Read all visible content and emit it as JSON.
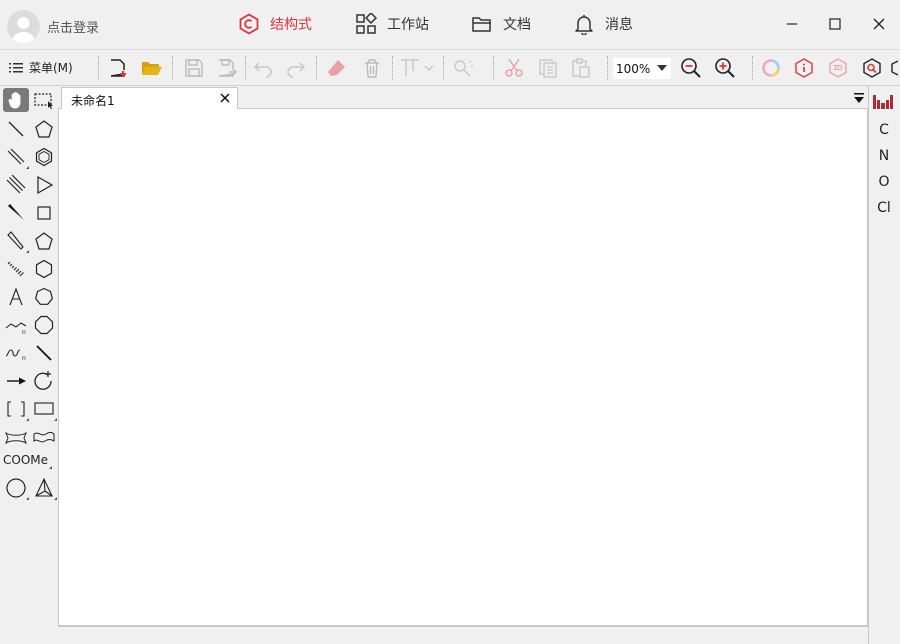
{
  "user": {
    "login_label": "点击登录"
  },
  "nav": [
    {
      "label": "结构式",
      "icon": "structure-icon",
      "active": true
    },
    {
      "label": "工作站",
      "icon": "workstation-icon"
    },
    {
      "label": "文档",
      "icon": "folder-icon"
    },
    {
      "label": "消息",
      "icon": "bell-icon"
    }
  ],
  "toolbar": {
    "menu_label": "菜单(M)",
    "zoom_value": "100%"
  },
  "tools": [
    "hand-tool",
    "marquee-select-tool",
    "single-bond-tool",
    "pentagon-ring-tool",
    "double-bond-tool",
    "hexagon-ring-tool",
    "triple-bond-tool",
    "triangle-ring-tool",
    "wedge-bond-tool",
    "square-ring-tool",
    "hashed-wedge-bond-tool",
    "pentagon-ring-tool-2",
    "hashed-bond-tool",
    "hexagon-ring-tool-2",
    "text-tool",
    "heptagon-ring-tool",
    "chain-tool",
    "octagon-ring-tool",
    "wavy-bond-tool",
    "bold-line-tool",
    "arrow-tool",
    "cycle-arrow-tool",
    "bracket-tool",
    "rectangle-tool",
    "ribbon-tool",
    "ribbon-tool-2",
    "abbreviation-tool",
    "circle-tool",
    "3d-shape-tool"
  ],
  "tool_text": {
    "abbreviation": "COOMe"
  },
  "document": {
    "tab_title": "未命名1"
  },
  "elements": [
    "C",
    "N",
    "O",
    "Cl"
  ],
  "colors": {
    "accent": "#d9373f",
    "folder": "#d4a20d"
  }
}
